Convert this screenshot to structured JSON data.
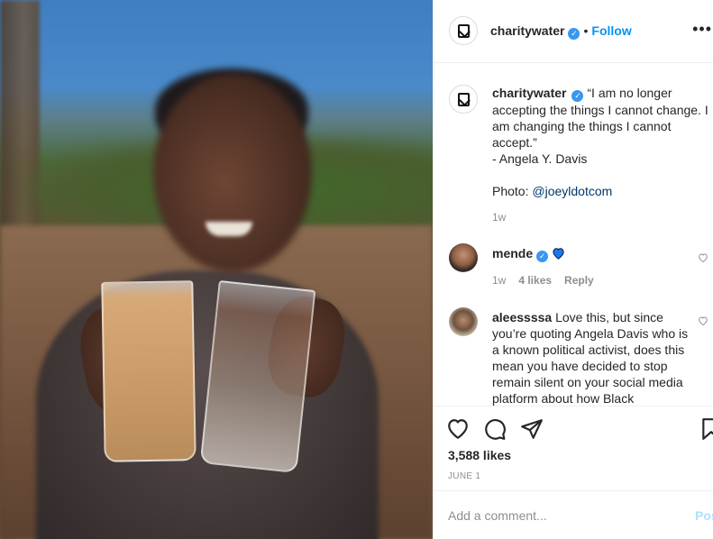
{
  "post": {
    "account": "charitywater",
    "follow_label": "Follow",
    "separator": "•",
    "more_label": "•••"
  },
  "caption": {
    "username": "charitywater",
    "text_line1": "“I am no longer accepting the things I cannot change. I am changing the things I cannot accept.”",
    "text_line2": "- Angela Y. Davis",
    "photo_prefix": "Photo: ",
    "photo_credit": "@joeyldotcom",
    "time": "1w"
  },
  "comments": [
    {
      "username": "mende",
      "text": "",
      "time": "1w",
      "likes": "4 likes",
      "reply": "Reply"
    },
    {
      "username": "aleessssa",
      "text": "Love this, but since you’re quoting Angela Davis who is a known political activist, does this mean you have decided to stop remain silent on your social media platform about how Black"
    }
  ],
  "actions": {
    "likes": "3,588 likes",
    "date": "JUNE 1"
  },
  "comment_box": {
    "placeholder": "Add a comment...",
    "post_label": "Post"
  },
  "icons": {
    "like": "heart-icon",
    "comment": "comment-icon",
    "share": "share-icon",
    "save": "bookmark-icon",
    "verified": "verified-badge-icon",
    "comment_like": "small-heart-icon"
  },
  "colors": {
    "accent": "#0095f6",
    "verified": "#3897f0",
    "blue_heart": "#0095f6",
    "muted": "#8e8e8e"
  }
}
